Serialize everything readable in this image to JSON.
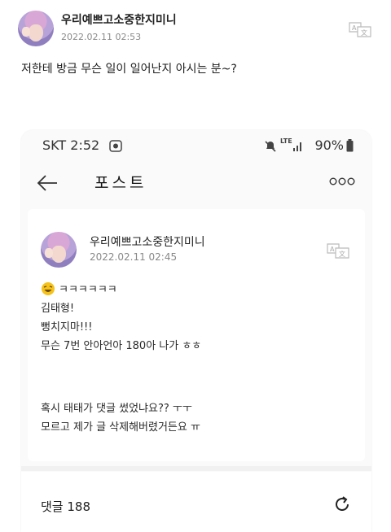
{
  "top_post": {
    "author": "우리예쁘고소중한지미니",
    "date": "2022.02.11 02:53",
    "body": "저한테 방금 무슨 일이 일어난지 아시는 분~?"
  },
  "screenshot": {
    "status_bar": {
      "carrier_time": "SKT 2:52",
      "network": "LTE",
      "battery": "90%"
    },
    "nav": {
      "title": "포스트"
    },
    "post": {
      "author": "우리예쁘고소중한지미니",
      "date": "2022.02.11 02:45",
      "lines": [
        "ㅋㅋㅋㅋㅋㅋ",
        "김태형!",
        "뻥치지마!!!",
        "무슨 7번 안아언아 180아 나가 ㅎㅎ",
        "혹시 태태가 댓글 썼었냐요?? ㅜㅜ",
        "모르고 제가 글 삭제해버렸거든요 ㅠ"
      ]
    },
    "comments": {
      "label": "댓글 188"
    }
  },
  "colors": {
    "avatar_hair": "#c9a3d8",
    "emoji": "#f4c21a"
  },
  "icons": [
    "translate-icon",
    "back-arrow-icon",
    "more-icon",
    "mute-icon",
    "signal-icon",
    "battery-icon",
    "refresh-icon",
    "laughing-emoji-icon",
    "gallery-icon"
  ]
}
